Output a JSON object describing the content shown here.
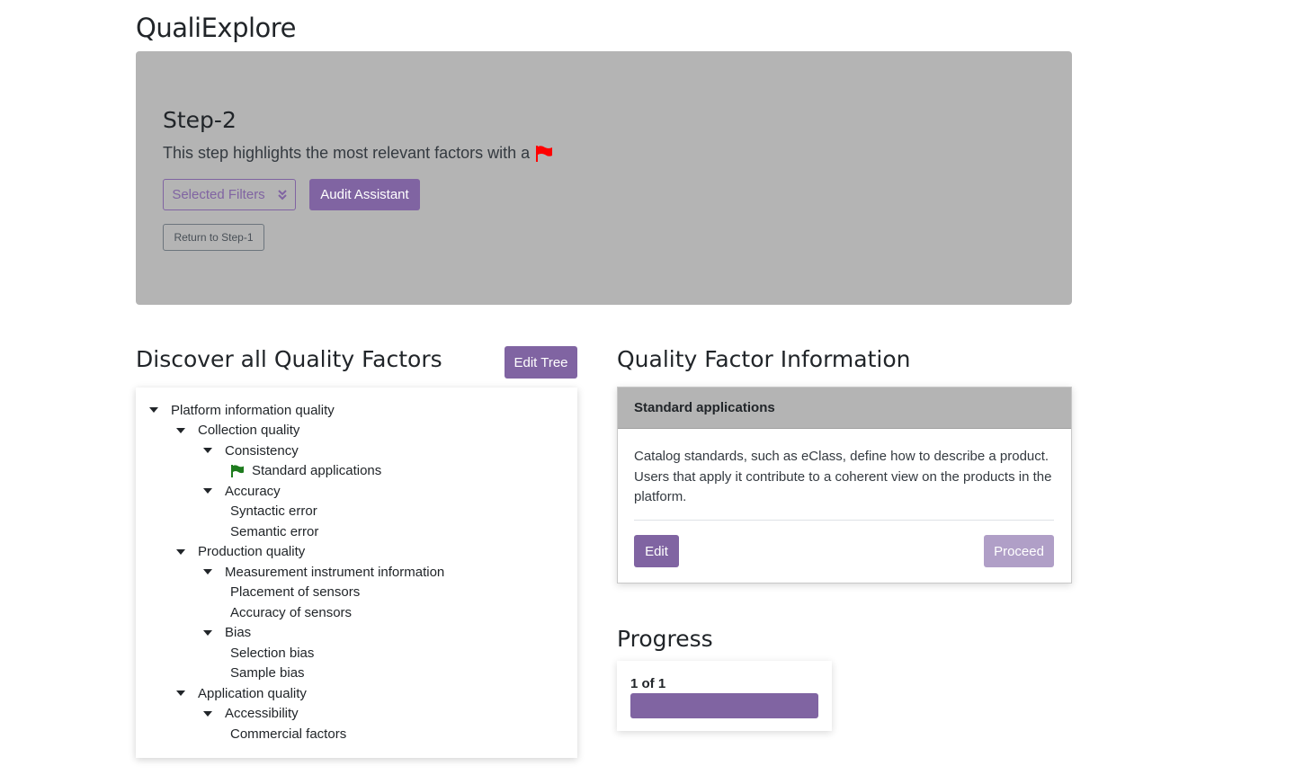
{
  "app": {
    "title": "QualiExplore"
  },
  "step": {
    "title": "Step-2",
    "description": "This step highlights the most relevant factors with a",
    "filters_label": "Selected Filters",
    "audit_label": "Audit Assistant",
    "return_label": "Return to Step-1",
    "accent": "#8064a2"
  },
  "tree_section": {
    "title": "Discover all Quality Factors",
    "edit_label": "Edit Tree",
    "nodes": [
      {
        "label": "Platform information quality",
        "caret": true,
        "flag": false,
        "level": 0
      },
      {
        "label": "Collection quality",
        "caret": true,
        "flag": false,
        "level": 1
      },
      {
        "label": "Consistency",
        "caret": true,
        "flag": false,
        "level": 2
      },
      {
        "label": "Standard applications",
        "caret": false,
        "flag": true,
        "level": 3
      },
      {
        "label": "Accuracy",
        "caret": true,
        "flag": false,
        "level": 2
      },
      {
        "label": "Syntactic error",
        "caret": false,
        "flag": false,
        "level": 3
      },
      {
        "label": "Semantic error",
        "caret": false,
        "flag": false,
        "level": 3
      },
      {
        "label": "Production quality",
        "caret": true,
        "flag": false,
        "level": 1
      },
      {
        "label": "Measurement instrument information",
        "caret": true,
        "flag": false,
        "level": 2
      },
      {
        "label": "Placement of sensors",
        "caret": false,
        "flag": false,
        "level": 3
      },
      {
        "label": "Accuracy of sensors",
        "caret": false,
        "flag": false,
        "level": 3
      },
      {
        "label": "Bias",
        "caret": true,
        "flag": false,
        "level": 2
      },
      {
        "label": "Selection bias",
        "caret": false,
        "flag": false,
        "level": 3
      },
      {
        "label": "Sample bias",
        "caret": false,
        "flag": false,
        "level": 3
      },
      {
        "label": "Application quality",
        "caret": true,
        "flag": false,
        "level": 1
      },
      {
        "label": "Accessibility",
        "caret": true,
        "flag": false,
        "level": 2
      },
      {
        "label": "Commercial factors",
        "caret": false,
        "flag": false,
        "level": 3
      }
    ]
  },
  "info_section": {
    "title": "Quality Factor Information",
    "card_title": "Standard applications",
    "card_body": "Catalog standards, such as eClass, define how to describe a product. Users that apply it contribute to a coherent view on the products in the platform.",
    "edit_label": "Edit",
    "proceed_label": "Proceed"
  },
  "progress": {
    "title": "Progress",
    "label": "1 of 1",
    "fraction": 1.0
  }
}
